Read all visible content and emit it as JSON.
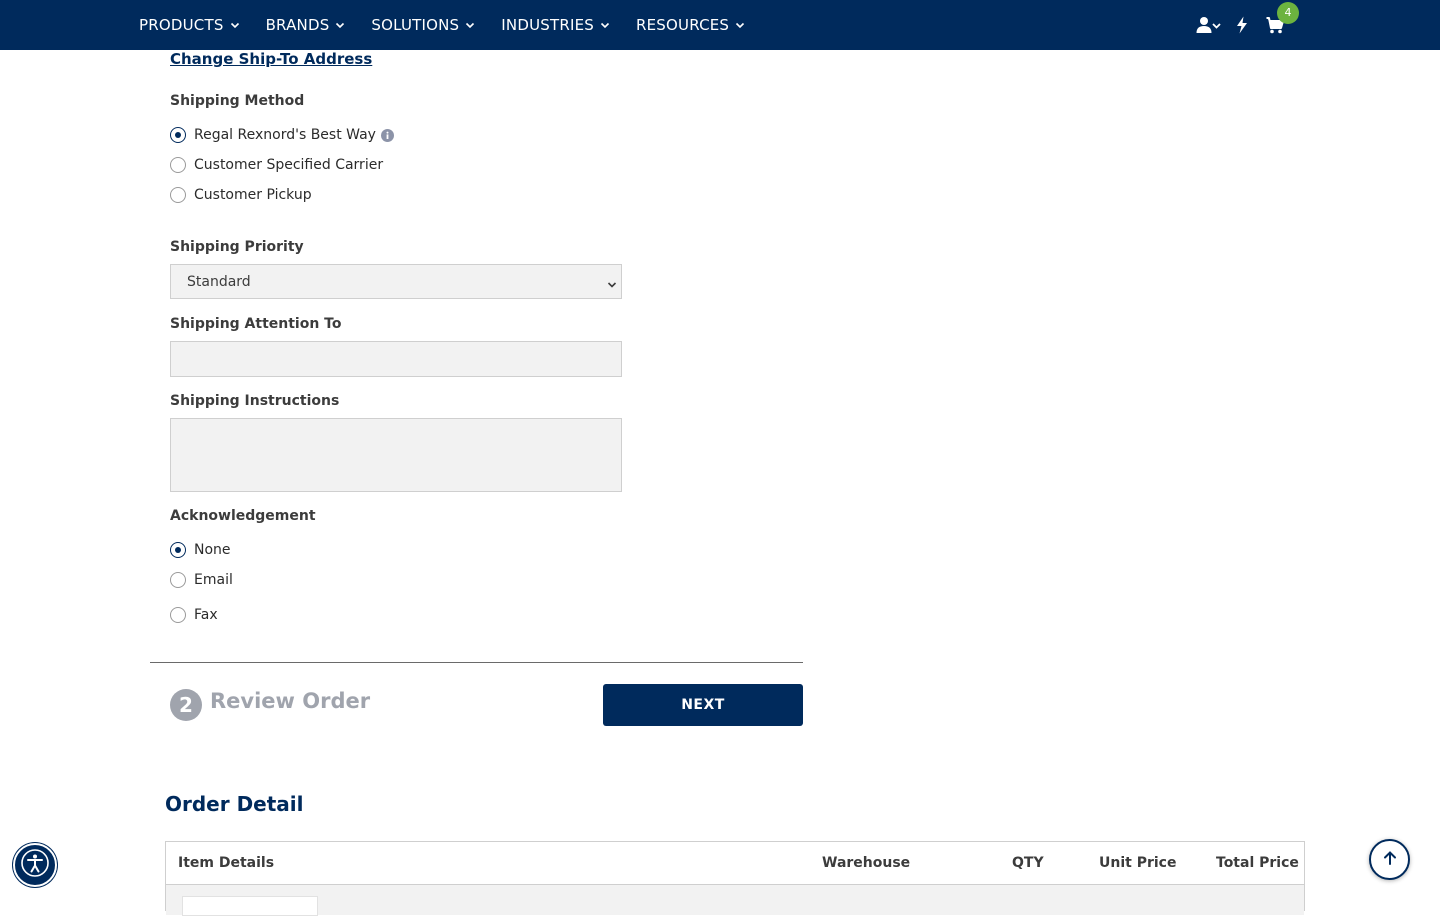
{
  "nav": {
    "items": [
      {
        "label": "PRODUCTS"
      },
      {
        "label": "BRANDS"
      },
      {
        "label": "SOLUTIONS"
      },
      {
        "label": "INDUSTRIES"
      },
      {
        "label": "RESOURCES"
      }
    ],
    "icons": [
      "account-icon",
      "quick-order-icon",
      "cart-icon"
    ],
    "cart_count": "4"
  },
  "shipping": {
    "change_address_link": "Change Ship-To Address",
    "method_label": "Shipping Method",
    "methods": [
      {
        "label": "Regal Rexnord's Best Way",
        "checked": true
      },
      {
        "label": "Customer Specified Carrier",
        "checked": false
      },
      {
        "label": "Customer Pickup",
        "checked": false
      }
    ],
    "priority_label": "Shipping Priority",
    "priority_value": "Standard",
    "attention_label": "Shipping Attention To",
    "attention_value": "",
    "instructions_label": "Shipping Instructions",
    "instructions_value": ""
  },
  "acknowledgement": {
    "label": "Acknowledgement",
    "options": [
      {
        "label": "None",
        "checked": true
      },
      {
        "label": "Email",
        "checked": false
      },
      {
        "label": "Fax",
        "checked": false
      }
    ]
  },
  "review_step": {
    "number": "2",
    "title": "Review Order",
    "next_label": "NEXT"
  },
  "order_detail": {
    "title": "Order Detail",
    "columns": [
      "Item Details",
      "Warehouse",
      "QTY",
      "Unit Price",
      "Total Price"
    ]
  },
  "colors": {
    "brand_navy": "#002a5c",
    "badge_green": "#6cb33f",
    "step_gray": "#a0a4ad"
  }
}
